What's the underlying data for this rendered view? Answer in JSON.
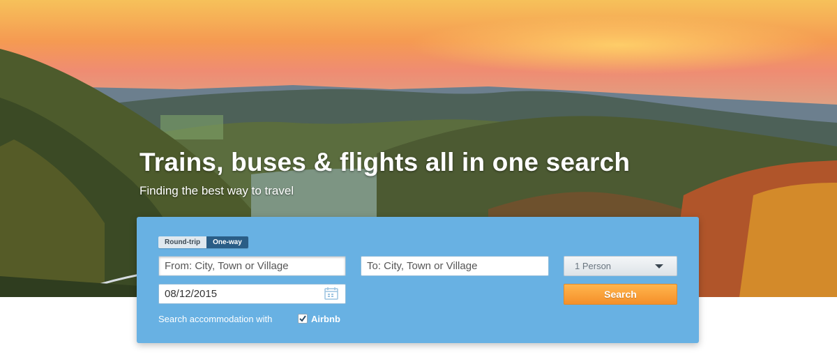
{
  "hero": {
    "headline": "Trains, buses & flights all in one search",
    "subheadline": "Finding the best way to travel"
  },
  "search": {
    "trip_type": {
      "round_trip_label": "Round-trip",
      "one_way_label": "One-way",
      "selected": "One-way"
    },
    "from_placeholder": "From: City, Town or Village",
    "to_placeholder": "To: City, Town or Village",
    "date_value": "08/12/2015",
    "passengers_value": "1 Person",
    "search_button_label": "Search",
    "accommodation_label": "Search accommodation with",
    "accommodation_checked": true,
    "accommodation_partner": "Airbnb"
  },
  "colors": {
    "panel": "#68b1e3",
    "active_toggle": "#2a5d86",
    "search_button": "#f5902a"
  },
  "icons": {
    "calendar": "calendar-icon",
    "dropdown": "chevron-down-icon",
    "checkbox": "checkmark-icon"
  }
}
